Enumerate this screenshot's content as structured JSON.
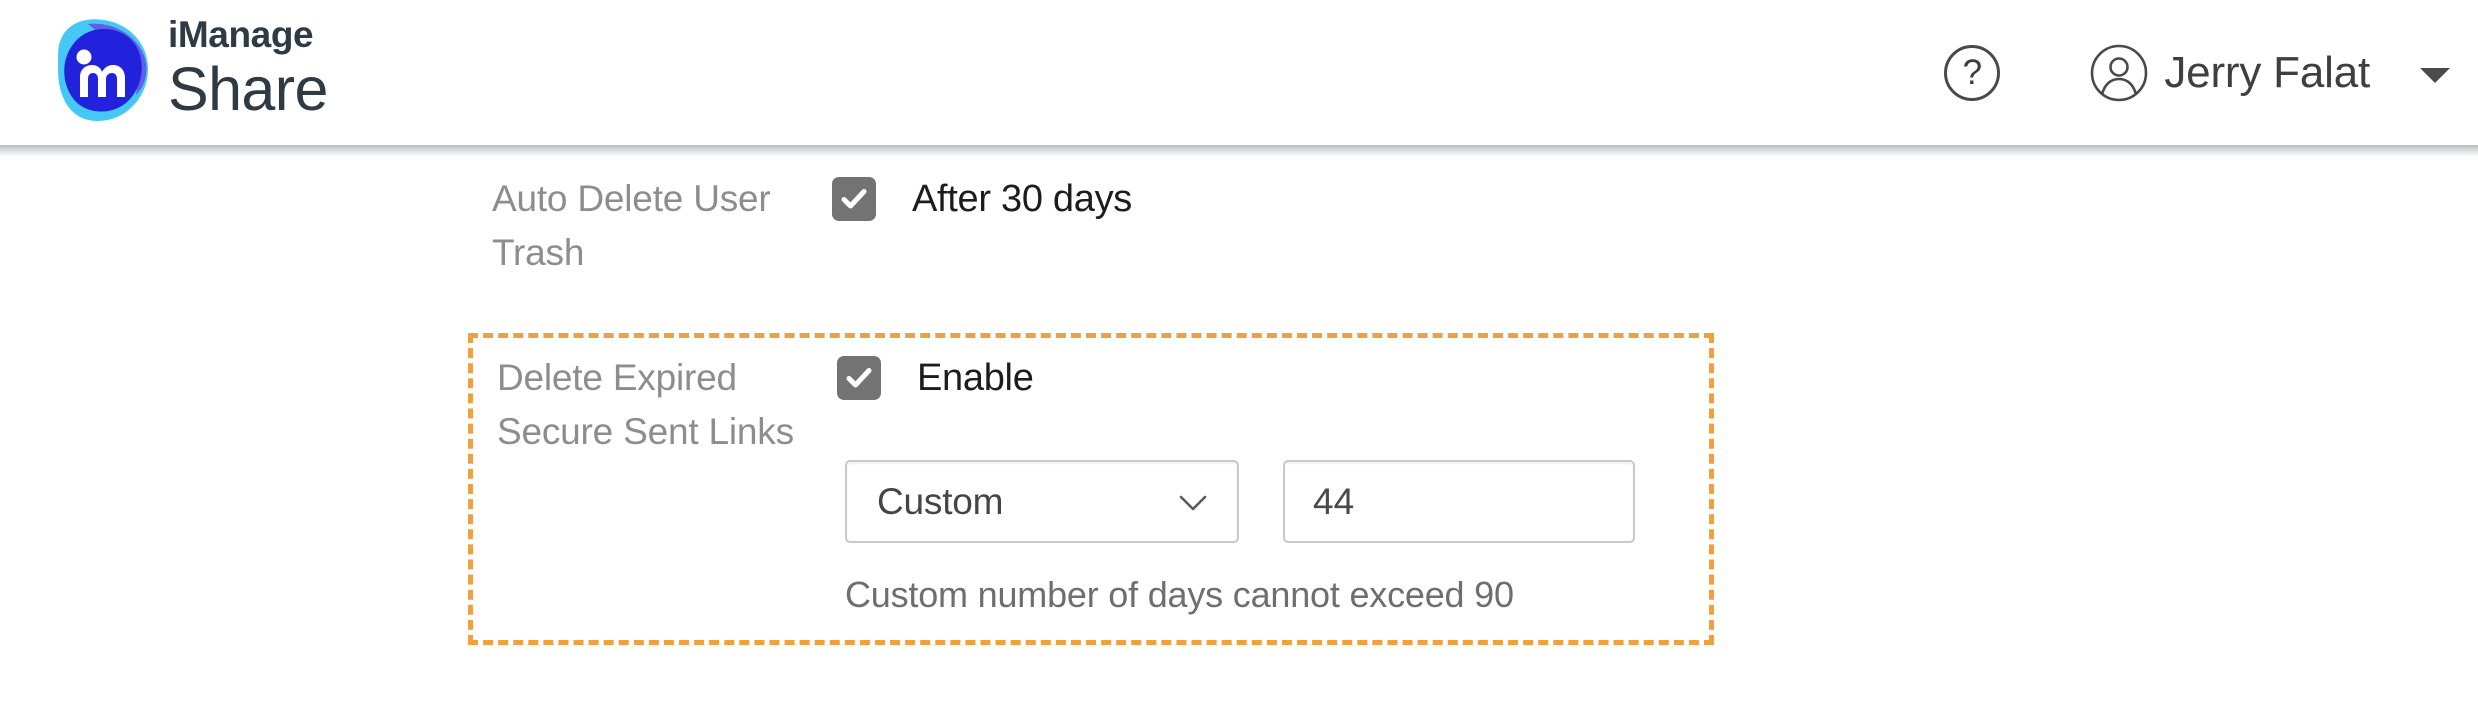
{
  "header": {
    "brand": {
      "line1": "iManage",
      "line2": "Share",
      "logo_icon": "imanage-m-logo-icon",
      "colors": {
        "light_blue": "#45c8f5",
        "dark_blue": "#2222dd",
        "purple": "#5f5fe8",
        "wordmark": "#2e3a44"
      }
    },
    "help": {
      "icon": "help-question-icon",
      "label": "?"
    },
    "user": {
      "avatar_icon": "user-avatar-icon",
      "name": "Jerry Falat",
      "caret_icon": "caret-down-icon"
    }
  },
  "settings": {
    "auto_delete_user_trash": {
      "label": "Auto Delete User Trash",
      "checkbox": {
        "icon": "checkmark-icon",
        "checked": true,
        "label": "After 30 days"
      }
    },
    "delete_expired_secure_sent_links": {
      "label": "Delete Expired Secure Sent Links",
      "highlighted": true,
      "highlight_color": "#f0a13c",
      "checkbox": {
        "icon": "checkmark-icon",
        "checked": true,
        "label": "Enable"
      },
      "duration_select": {
        "value": "Custom",
        "chevron_icon": "chevron-down-icon",
        "options": [
          "Custom"
        ]
      },
      "days_input": {
        "value": "44",
        "placeholder": ""
      },
      "hint": "Custom number of days cannot exceed 90"
    }
  }
}
